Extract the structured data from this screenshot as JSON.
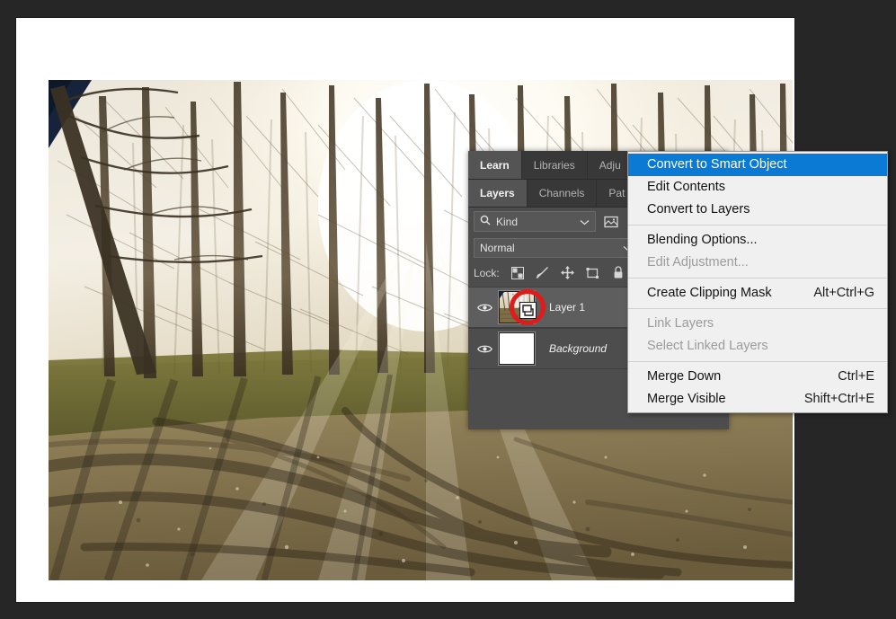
{
  "document": {
    "canvas_background": "#ffffff",
    "app_background": "#262626",
    "photo_alt": "Backlit forest of bare trees with sun flare over a muddy dirt path"
  },
  "panel": {
    "background": "#4d4d4d",
    "tab_groups": [
      {
        "name": "upper-tab-group",
        "tabs": [
          {
            "label": "Learn",
            "active": true
          },
          {
            "label": "Libraries",
            "active": false
          },
          {
            "label": "Adju",
            "active": false
          }
        ]
      },
      {
        "name": "lower-tab-group",
        "tabs": [
          {
            "label": "Layers",
            "active": true
          },
          {
            "label": "Channels",
            "active": false
          },
          {
            "label": "Pat",
            "active": false
          }
        ]
      }
    ],
    "filter_row": {
      "kind_label": "Kind",
      "search_icon": "search-icon",
      "chevron_icon": "chevron-down-icon",
      "filter_icons": [
        "image-filter-icon",
        "adjustment-filter-icon"
      ]
    },
    "blend_row": {
      "blend_mode": "Normal",
      "chevron_icon": "chevron-down-icon"
    },
    "lock_row": {
      "label": "Lock:",
      "icons": [
        "lock-transparent-pixels-icon",
        "lock-image-pixels-icon",
        "lock-position-icon",
        "lock-artboard-nesting-icon",
        "lock-all-icon"
      ]
    },
    "layers": [
      {
        "name": "Layer 1",
        "visible": true,
        "selected": true,
        "italic": false,
        "thumbnail": "forest-photo-thumbnail",
        "badge": "smart-object-badge",
        "annotated": true
      },
      {
        "name": "Background",
        "visible": true,
        "selected": false,
        "italic": true,
        "thumbnail": "white-thumbnail",
        "badge": null,
        "annotated": false
      }
    ],
    "annotation": {
      "shape": "circle",
      "color": "#e01b1b",
      "target": "smart-object-badge"
    }
  },
  "context_menu": {
    "background": "#f0f0f0",
    "highlight_color": "#0b7ad4",
    "items": [
      {
        "label": "Convert to Smart Object",
        "shortcut": "",
        "highlighted": true,
        "disabled": false,
        "separator_after": false
      },
      {
        "label": "Edit Contents",
        "shortcut": "",
        "highlighted": false,
        "disabled": false,
        "separator_after": false
      },
      {
        "label": "Convert to Layers",
        "shortcut": "",
        "highlighted": false,
        "disabled": false,
        "separator_after": true
      },
      {
        "label": "Blending Options...",
        "shortcut": "",
        "highlighted": false,
        "disabled": false,
        "separator_after": false
      },
      {
        "label": "Edit Adjustment...",
        "shortcut": "",
        "highlighted": false,
        "disabled": true,
        "separator_after": true
      },
      {
        "label": "Create Clipping Mask",
        "shortcut": "Alt+Ctrl+G",
        "highlighted": false,
        "disabled": false,
        "separator_after": true
      },
      {
        "label": "Link Layers",
        "shortcut": "",
        "highlighted": false,
        "disabled": true,
        "separator_after": false
      },
      {
        "label": "Select Linked Layers",
        "shortcut": "",
        "highlighted": false,
        "disabled": true,
        "separator_after": true
      },
      {
        "label": "Merge Down",
        "shortcut": "Ctrl+E",
        "highlighted": false,
        "disabled": false,
        "separator_after": false
      },
      {
        "label": "Merge Visible",
        "shortcut": "Shift+Ctrl+E",
        "highlighted": false,
        "disabled": false,
        "separator_after": false
      }
    ]
  }
}
